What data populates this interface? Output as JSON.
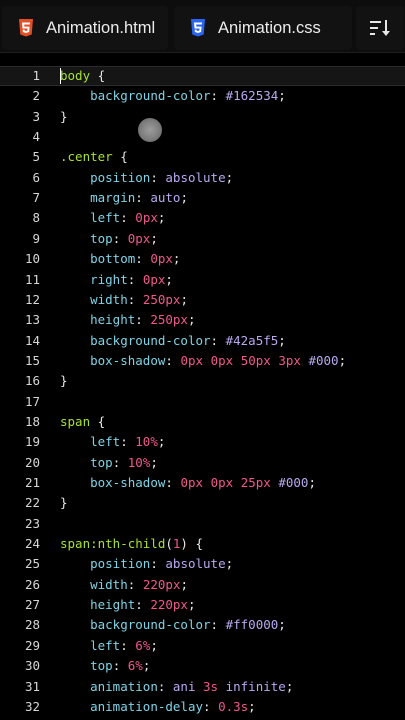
{
  "tabs": [
    {
      "label": "Animation.html",
      "icon": "html5-icon",
      "color": "#e34f26"
    },
    {
      "label": "Animation.css",
      "icon": "css3-icon",
      "color": "#2965f1"
    }
  ],
  "toolbar": {
    "sort_icon": "sort-icon"
  },
  "editor": {
    "current_line": 1,
    "lines": [
      {
        "n": "1",
        "t": [
          [
            "sel",
            "body"
          ],
          [
            "pun",
            " {"
          ]
        ]
      },
      {
        "n": "2",
        "t": [
          [
            "pun",
            "    "
          ],
          [
            "prop",
            "background-color"
          ],
          [
            "pun",
            ": "
          ],
          [
            "val",
            "#162534"
          ],
          [
            "pun",
            ";"
          ]
        ]
      },
      {
        "n": "3",
        "t": [
          [
            "pun",
            "}"
          ]
        ]
      },
      {
        "n": "4",
        "t": []
      },
      {
        "n": "5",
        "t": [
          [
            "sel",
            ".center"
          ],
          [
            "pun",
            " {"
          ]
        ]
      },
      {
        "n": "6",
        "t": [
          [
            "pun",
            "    "
          ],
          [
            "prop",
            "position"
          ],
          [
            "pun",
            ": "
          ],
          [
            "val",
            "absolute"
          ],
          [
            "pun",
            ";"
          ]
        ]
      },
      {
        "n": "7",
        "t": [
          [
            "pun",
            "    "
          ],
          [
            "prop",
            "margin"
          ],
          [
            "pun",
            ": "
          ],
          [
            "val",
            "auto"
          ],
          [
            "pun",
            ";"
          ]
        ]
      },
      {
        "n": "8",
        "t": [
          [
            "pun",
            "    "
          ],
          [
            "prop",
            "left"
          ],
          [
            "pun",
            ": "
          ],
          [
            "num",
            "0"
          ],
          [
            "unit",
            "px"
          ],
          [
            "pun",
            ";"
          ]
        ]
      },
      {
        "n": "9",
        "t": [
          [
            "pun",
            "    "
          ],
          [
            "prop",
            "top"
          ],
          [
            "pun",
            ": "
          ],
          [
            "num",
            "0"
          ],
          [
            "unit",
            "px"
          ],
          [
            "pun",
            ";"
          ]
        ]
      },
      {
        "n": "10",
        "t": [
          [
            "pun",
            "    "
          ],
          [
            "prop",
            "bottom"
          ],
          [
            "pun",
            ": "
          ],
          [
            "num",
            "0"
          ],
          [
            "unit",
            "px"
          ],
          [
            "pun",
            ";"
          ]
        ]
      },
      {
        "n": "11",
        "t": [
          [
            "pun",
            "    "
          ],
          [
            "prop",
            "right"
          ],
          [
            "pun",
            ": "
          ],
          [
            "num",
            "0"
          ],
          [
            "unit",
            "px"
          ],
          [
            "pun",
            ";"
          ]
        ]
      },
      {
        "n": "12",
        "t": [
          [
            "pun",
            "    "
          ],
          [
            "prop",
            "width"
          ],
          [
            "pun",
            ": "
          ],
          [
            "num",
            "250"
          ],
          [
            "unit",
            "px"
          ],
          [
            "pun",
            ";"
          ]
        ]
      },
      {
        "n": "13",
        "t": [
          [
            "pun",
            "    "
          ],
          [
            "prop",
            "height"
          ],
          [
            "pun",
            ": "
          ],
          [
            "num",
            "250"
          ],
          [
            "unit",
            "px"
          ],
          [
            "pun",
            ";"
          ]
        ]
      },
      {
        "n": "14",
        "t": [
          [
            "pun",
            "    "
          ],
          [
            "prop",
            "background-color"
          ],
          [
            "pun",
            ": "
          ],
          [
            "val",
            "#42a5f5"
          ],
          [
            "pun",
            ";"
          ]
        ]
      },
      {
        "n": "15",
        "t": [
          [
            "pun",
            "    "
          ],
          [
            "prop",
            "box-shadow"
          ],
          [
            "pun",
            ": "
          ],
          [
            "num",
            "0"
          ],
          [
            "unit",
            "px"
          ],
          [
            "pun",
            " "
          ],
          [
            "num",
            "0"
          ],
          [
            "unit",
            "px"
          ],
          [
            "pun",
            " "
          ],
          [
            "num",
            "50"
          ],
          [
            "unit",
            "px"
          ],
          [
            "pun",
            " "
          ],
          [
            "num",
            "3"
          ],
          [
            "unit",
            "px"
          ],
          [
            "pun",
            " "
          ],
          [
            "val",
            "#000"
          ],
          [
            "pun",
            ";"
          ]
        ]
      },
      {
        "n": "16",
        "t": [
          [
            "pun",
            "}"
          ]
        ]
      },
      {
        "n": "17",
        "t": []
      },
      {
        "n": "18",
        "t": [
          [
            "sel",
            "span"
          ],
          [
            "pun",
            " {"
          ]
        ]
      },
      {
        "n": "19",
        "t": [
          [
            "pun",
            "    "
          ],
          [
            "prop",
            "left"
          ],
          [
            "pun",
            ": "
          ],
          [
            "num",
            "10"
          ],
          [
            "unit",
            "%"
          ],
          [
            "pun",
            ";"
          ]
        ]
      },
      {
        "n": "20",
        "t": [
          [
            "pun",
            "    "
          ],
          [
            "prop",
            "top"
          ],
          [
            "pun",
            ": "
          ],
          [
            "num",
            "10"
          ],
          [
            "unit",
            "%"
          ],
          [
            "pun",
            ";"
          ]
        ]
      },
      {
        "n": "21",
        "t": [
          [
            "pun",
            "    "
          ],
          [
            "prop",
            "box-shadow"
          ],
          [
            "pun",
            ": "
          ],
          [
            "num",
            "0"
          ],
          [
            "unit",
            "px"
          ],
          [
            "pun",
            " "
          ],
          [
            "num",
            "0"
          ],
          [
            "unit",
            "px"
          ],
          [
            "pun",
            " "
          ],
          [
            "num",
            "25"
          ],
          [
            "unit",
            "px"
          ],
          [
            "pun",
            " "
          ],
          [
            "val",
            "#000"
          ],
          [
            "pun",
            ";"
          ]
        ]
      },
      {
        "n": "22",
        "t": [
          [
            "pun",
            "}"
          ]
        ]
      },
      {
        "n": "23",
        "t": []
      },
      {
        "n": "24",
        "t": [
          [
            "sel",
            "span:nth-child"
          ],
          [
            "pun",
            "("
          ],
          [
            "num",
            "1"
          ],
          [
            "pun",
            ") {"
          ]
        ]
      },
      {
        "n": "25",
        "t": [
          [
            "pun",
            "    "
          ],
          [
            "prop",
            "position"
          ],
          [
            "pun",
            ": "
          ],
          [
            "val",
            "absolute"
          ],
          [
            "pun",
            ";"
          ]
        ]
      },
      {
        "n": "26",
        "t": [
          [
            "pun",
            "    "
          ],
          [
            "prop",
            "width"
          ],
          [
            "pun",
            ": "
          ],
          [
            "num",
            "220"
          ],
          [
            "unit",
            "px"
          ],
          [
            "pun",
            ";"
          ]
        ]
      },
      {
        "n": "27",
        "t": [
          [
            "pun",
            "    "
          ],
          [
            "prop",
            "height"
          ],
          [
            "pun",
            ": "
          ],
          [
            "num",
            "220"
          ],
          [
            "unit",
            "px"
          ],
          [
            "pun",
            ";"
          ]
        ]
      },
      {
        "n": "28",
        "t": [
          [
            "pun",
            "    "
          ],
          [
            "prop",
            "background-color"
          ],
          [
            "pun",
            ": "
          ],
          [
            "val",
            "#ff0000"
          ],
          [
            "pun",
            ";"
          ]
        ]
      },
      {
        "n": "29",
        "t": [
          [
            "pun",
            "    "
          ],
          [
            "prop",
            "left"
          ],
          [
            "pun",
            ": "
          ],
          [
            "num",
            "6"
          ],
          [
            "unit",
            "%"
          ],
          [
            "pun",
            ";"
          ]
        ]
      },
      {
        "n": "30",
        "t": [
          [
            "pun",
            "    "
          ],
          [
            "prop",
            "top"
          ],
          [
            "pun",
            ": "
          ],
          [
            "num",
            "6"
          ],
          [
            "unit",
            "%"
          ],
          [
            "pun",
            ";"
          ]
        ]
      },
      {
        "n": "31",
        "t": [
          [
            "pun",
            "    "
          ],
          [
            "prop",
            "animation"
          ],
          [
            "pun",
            ": "
          ],
          [
            "val",
            "ani "
          ],
          [
            "num",
            "3"
          ],
          [
            "unit",
            "s"
          ],
          [
            "val",
            " infinite"
          ],
          [
            "pun",
            ";"
          ]
        ]
      },
      {
        "n": "32",
        "t": [
          [
            "pun",
            "    "
          ],
          [
            "prop",
            "animation-delay"
          ],
          [
            "pun",
            ": "
          ],
          [
            "num",
            "0.3"
          ],
          [
            "unit",
            "s"
          ],
          [
            "pun",
            ";"
          ]
        ]
      }
    ]
  }
}
